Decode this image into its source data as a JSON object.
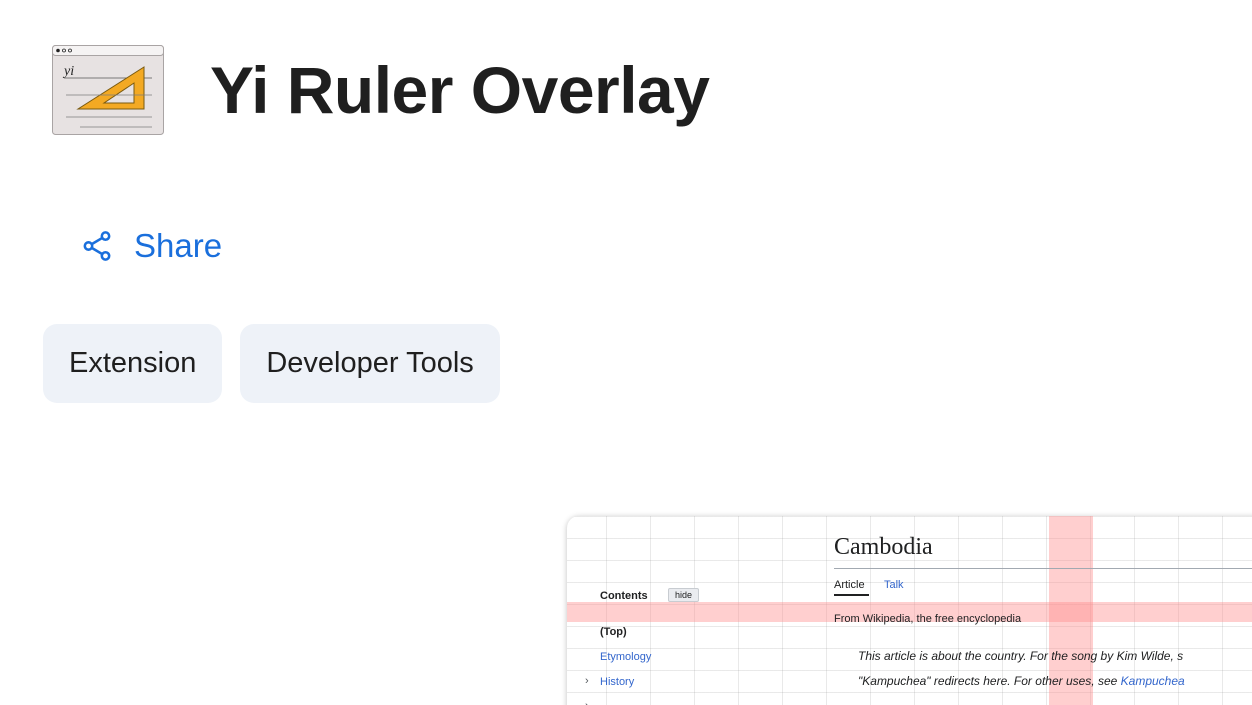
{
  "header": {
    "title": "Yi Ruler Overlay",
    "icon": "yi-ruler-logo-icon"
  },
  "share": {
    "label": "Share",
    "icon": "share-icon",
    "color": "#1a6fdc"
  },
  "chips": [
    {
      "label": "Extension"
    },
    {
      "label": "Developer Tools"
    }
  ],
  "preview": {
    "title": "Cambodia",
    "tabs": [
      "Article",
      "Talk"
    ],
    "contents_label": "Contents",
    "hide_label": "hide",
    "toc": [
      "(Top)",
      "Etymology",
      "History"
    ],
    "from_wiki": "From Wikipedia, the free encyclopedia",
    "hatnote_line1": "This article is about the country. For the song by Kim Wilde, s",
    "hatnote_line2_prefix": "\"Kampuchea\" redirects here. For other uses, see ",
    "hatnote_line2_link": "Kampuchea",
    "highlight_color": "#ff8c8c"
  }
}
